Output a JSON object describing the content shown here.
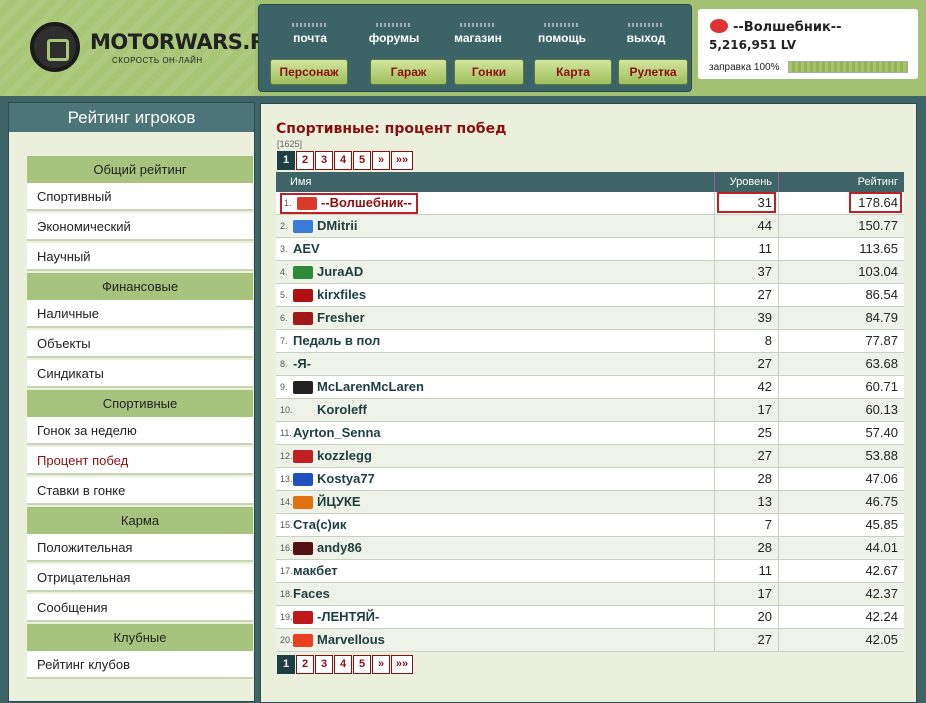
{
  "site": {
    "logo": "MOTORWARS.RU",
    "tagline": "СКОРОСТЬ ОН-ЛАЙН"
  },
  "toplinks": [
    "почта",
    "форумы",
    "магазин",
    "помощь",
    "выход"
  ],
  "navbuttons": [
    "Персонаж",
    "Гараж",
    "Гонки",
    "Карта",
    "Рулетка"
  ],
  "user": {
    "name": "--Волшебник--",
    "balance": "5,216,951 LV",
    "fuel_label": "заправка 100%",
    "fuel": 1.0
  },
  "sidebar": {
    "title": "Рейтинг игроков",
    "sections": [
      {
        "head": "Общий рейтинг",
        "items": [
          "Спортивный",
          "Экономический",
          "Научный"
        ]
      },
      {
        "head": "Финансовые",
        "items": [
          "Наличные",
          "Объекты",
          "Синдикаты"
        ]
      },
      {
        "head": "Спортивные",
        "items": [
          "Гонок за неделю",
          "Процент побед",
          "Ставки в гонке"
        ]
      },
      {
        "head": "Карма",
        "items": [
          "Положительная",
          "Отрицательная",
          "Сообщения"
        ]
      },
      {
        "head": "Клубные",
        "items": [
          "Рейтинг клубов"
        ]
      }
    ],
    "active": "Процент побед"
  },
  "content": {
    "title": "Спортивные: процент побед",
    "count": "[1625]",
    "pager": [
      "1",
      "2",
      "3",
      "4",
      "5",
      "»",
      "»»"
    ],
    "columns": {
      "name": "Имя",
      "level": "Уровень",
      "rating": "Рейтинг"
    },
    "rows": [
      {
        "rank": "1.",
        "name": "--Волшебник--",
        "level": "31",
        "rating": "178.64",
        "avatar_color": "#d93a2a"
      },
      {
        "rank": "2.",
        "name": "DMitrii",
        "level": "44",
        "rating": "150.77",
        "avatar_color": "#3a7bd5"
      },
      {
        "rank": "3.",
        "name": "AEV",
        "level": "11",
        "rating": "113.65",
        "avatar_color": ""
      },
      {
        "rank": "4.",
        "name": "JuraAD",
        "level": "37",
        "rating": "103.04",
        "avatar_color": "#2e8b3a"
      },
      {
        "rank": "5.",
        "name": "kirxfiles",
        "level": "27",
        "rating": "86.54",
        "avatar_color": "#b01010"
      },
      {
        "rank": "6.",
        "name": "Fresher",
        "level": "39",
        "rating": "84.79",
        "avatar_color": "#a01818"
      },
      {
        "rank": "7.",
        "name": "Педаль в пол",
        "level": "8",
        "rating": "77.87",
        "avatar_color": ""
      },
      {
        "rank": "8.",
        "name": "-Я-",
        "level": "27",
        "rating": "63.68",
        "avatar_color": ""
      },
      {
        "rank": "9.",
        "name": "McLarenMcLaren",
        "level": "42",
        "rating": "60.71",
        "avatar_color": "#222222"
      },
      {
        "rank": "10.",
        "name": "Koroleff",
        "level": "17",
        "rating": "60.13",
        "avatar_color": ""
      },
      {
        "rank": "11.",
        "name": "Ayrton_Senna",
        "level": "25",
        "rating": "57.40",
        "avatar_color": ""
      },
      {
        "rank": "12.",
        "name": "kozzlegg",
        "level": "27",
        "rating": "53.88",
        "avatar_color": "#c02020"
      },
      {
        "rank": "13.",
        "name": "Kostya77",
        "level": "28",
        "rating": "47.06",
        "avatar_color": "#2050c0"
      },
      {
        "rank": "14.",
        "name": "ЙЦУКЕ",
        "level": "13",
        "rating": "46.75",
        "avatar_color": "#e07010"
      },
      {
        "rank": "15.",
        "name": "Ста(с)ик",
        "level": "7",
        "rating": "45.85",
        "avatar_color": ""
      },
      {
        "rank": "16.",
        "name": "andy86",
        "level": "28",
        "rating": "44.01",
        "avatar_color": "#551111"
      },
      {
        "rank": "17.",
        "name": "макбет",
        "level": "11",
        "rating": "42.67",
        "avatar_color": ""
      },
      {
        "rank": "18.",
        "name": "Faces",
        "level": "17",
        "rating": "42.37",
        "avatar_color": ""
      },
      {
        "rank": "19.",
        "name": "-ЛЕНТЯЙ-",
        "level": "20",
        "rating": "42.24",
        "avatar_color": "#c01818"
      },
      {
        "rank": "20.",
        "name": "Marvellous",
        "level": "27",
        "rating": "42.05",
        "avatar_color": "#e84020"
      }
    ]
  }
}
